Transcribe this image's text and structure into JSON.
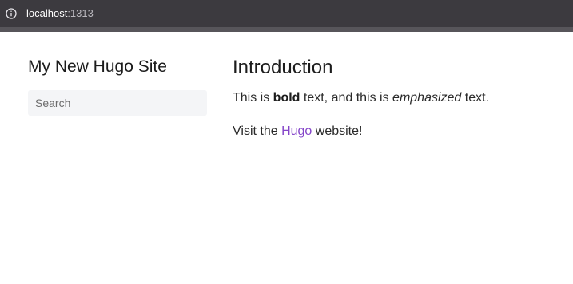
{
  "browser": {
    "url_host": "localhost",
    "url_port": ":1313",
    "info_icon": "info-icon"
  },
  "sidebar": {
    "site_title": "My New Hugo Site",
    "search_placeholder": "Search"
  },
  "main": {
    "heading": "Introduction",
    "paragraph1": {
      "before_bold": "This is ",
      "bold": "bold",
      "middle": " text, and this is ",
      "emphasized": "emphasized",
      "after": " text."
    },
    "paragraph2": {
      "before_link": "Visit the ",
      "link": "Hugo",
      "after_link": " website!"
    }
  },
  "colors": {
    "address_bar_bg": "#3c3a3f",
    "link": "#8545c9",
    "search_bg": "#f4f5f7"
  }
}
